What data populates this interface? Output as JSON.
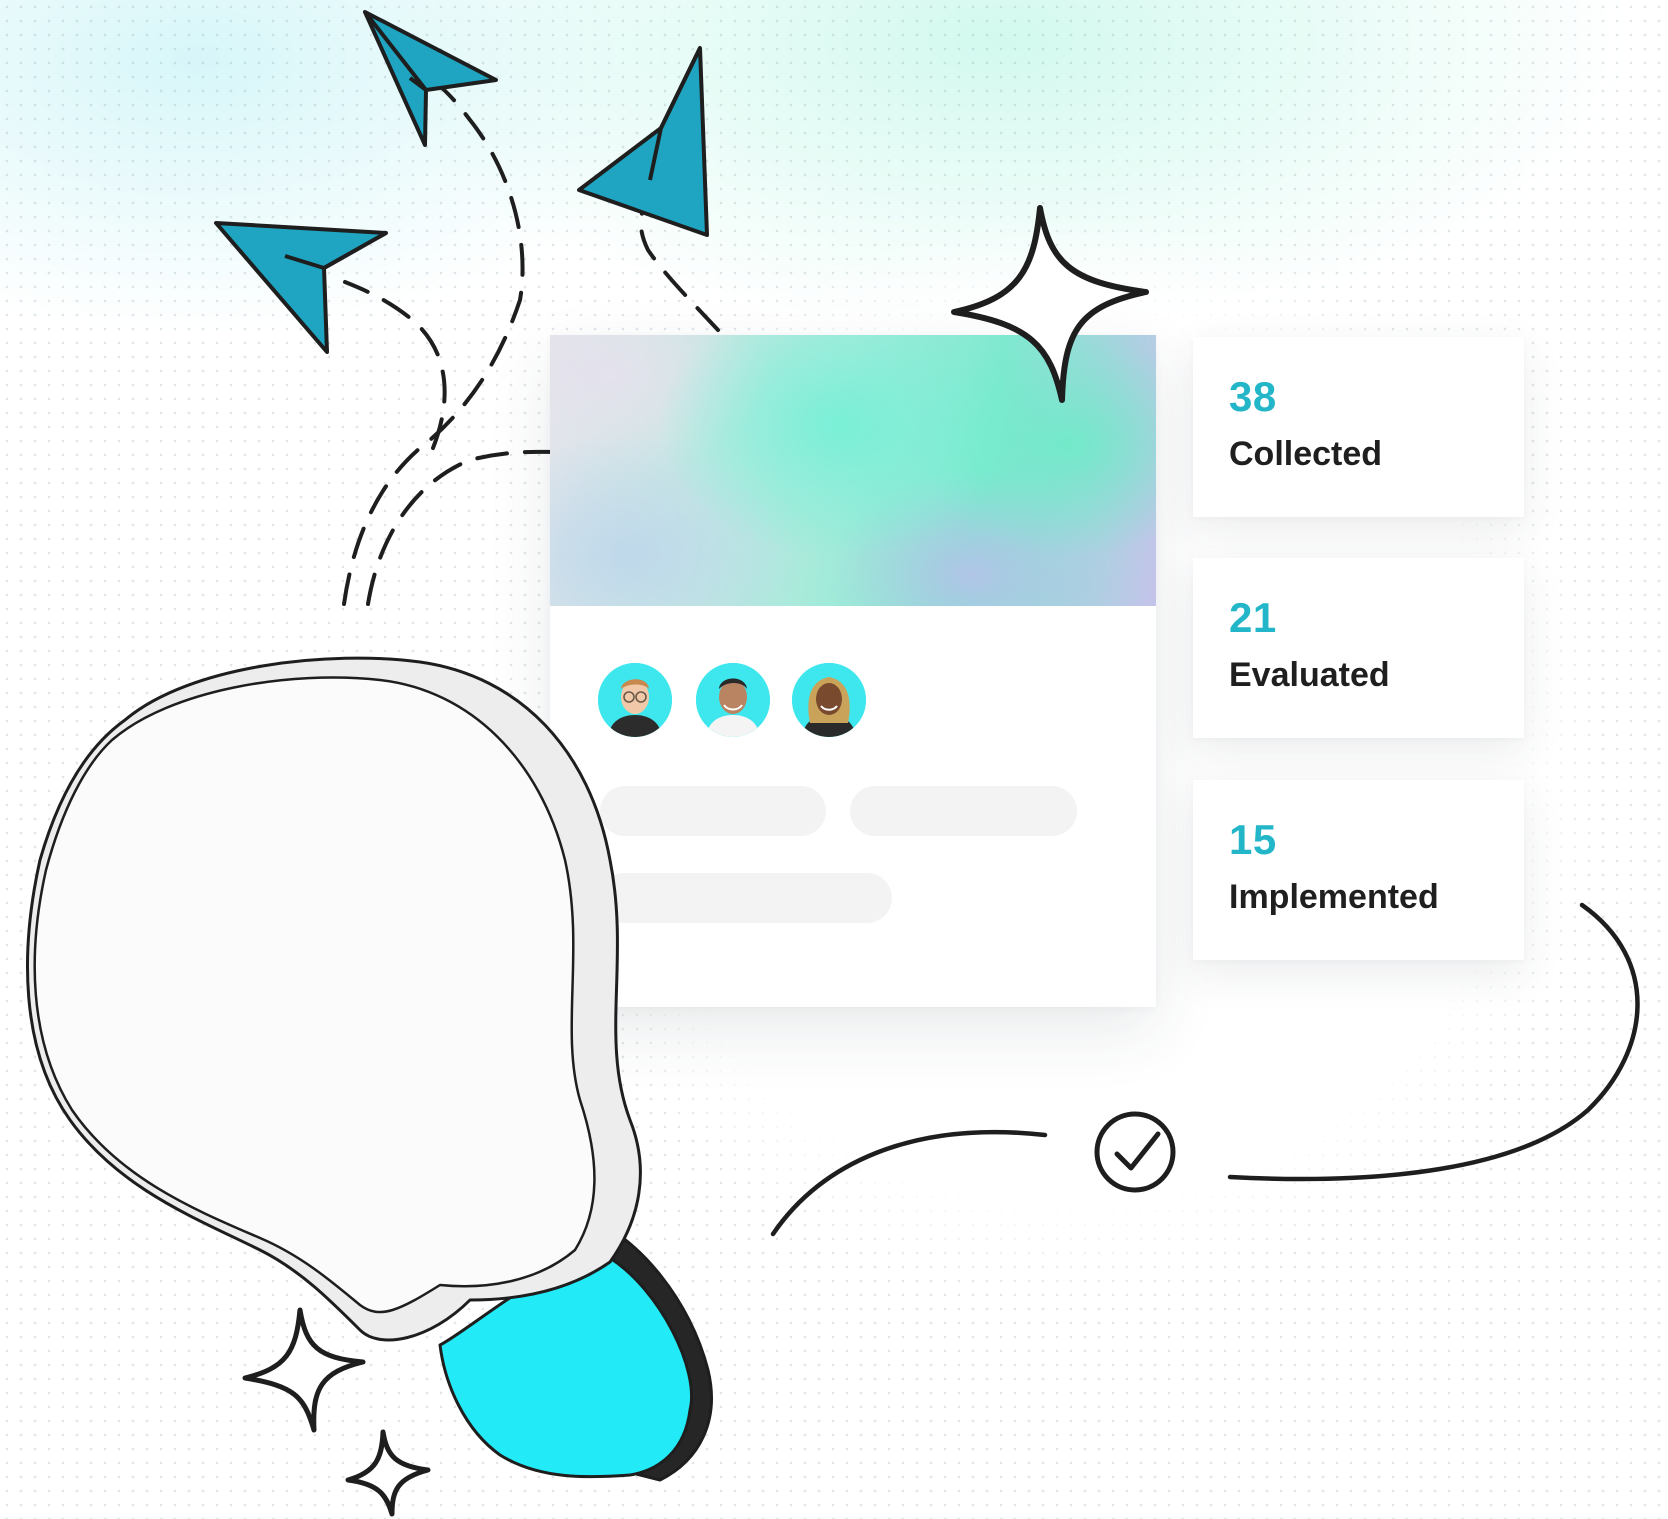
{
  "stats": [
    {
      "value": "38",
      "label": "Collected"
    },
    {
      "value": "21",
      "label": "Evaluated"
    },
    {
      "value": "15",
      "label": "Implemented"
    }
  ],
  "colors": {
    "accent": "#22b6c8",
    "plane": "#1fa5c2",
    "bulb_base": "#23eaf7",
    "stroke": "#1e1e1e",
    "avatar_bg": "#3ee7ee"
  },
  "icons": [
    "paper-plane-icon",
    "sparkle-icon",
    "lightbulb-icon",
    "check-circle-icon"
  ]
}
